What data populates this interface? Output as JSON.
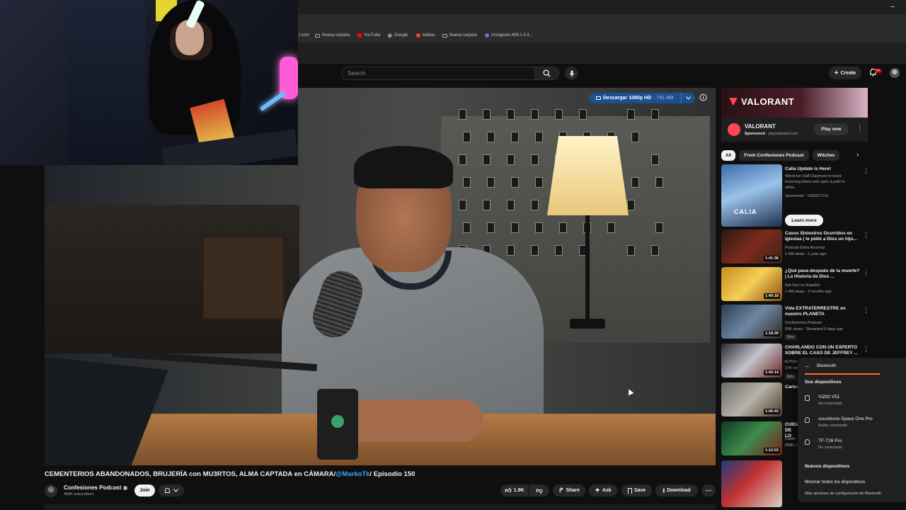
{
  "browser": {
    "bookmarks": [
      {
        "label": "t.com",
        "icon": "link-icon"
      },
      {
        "label": "Nueva carpeta",
        "icon": "folder-icon"
      },
      {
        "label": "YouTube",
        "icon": "youtube-icon"
      },
      {
        "label": "Google",
        "icon": "google-icon"
      },
      {
        "label": "bablas",
        "icon": "site-icon"
      },
      {
        "label": "Nueva carpeta",
        "icon": "folder-icon"
      },
      {
        "label": "Instagram-409.1.0.4...",
        "icon": "instagram-icon"
      }
    ]
  },
  "header": {
    "search_placeholder": "Search",
    "create_label": "Create",
    "notification_count": "9+"
  },
  "video": {
    "download_label": "Descargar 1080p HD",
    "download_size": "· 791 MB",
    "title_prefix": "CEMENTERIOS ABANDONADOS, BRUJERÍA con MU3RTOS, ALMA CAPTADA en CÁMARA/",
    "title_mention": "@MarkoTk",
    "title_suffix": "/ Episodio 150"
  },
  "channel": {
    "name": "Confesiones Podcast",
    "subscribers": "409K subscribers",
    "join_label": "Join"
  },
  "actions": {
    "likes": "1.9K",
    "share": "Share",
    "ask": "Ask",
    "save": "Save",
    "download": "Download"
  },
  "ad": {
    "banner_text": "VALORANT",
    "name": "VALORANT",
    "sponsored": "Sponsored",
    "domain": "· playvalorant.com",
    "cta": "Play now"
  },
  "chips": [
    "All",
    "From Confesiones Podcast",
    "Witches"
  ],
  "recommendations": [
    {
      "title": "Calia Update is Here!",
      "meta1": "Wield her Half Claymore to block incoming blows and open a path to strike.",
      "meta2": "Sponsored · VINDICTUS",
      "duration": "",
      "badge": "",
      "cta": "Learn more"
    },
    {
      "title": "Casos Siniestros Ocurridos en Iglesias | le pidió a Dios un hijo...",
      "meta1": "Podcast Extra Anormal",
      "meta2": "2.4M views · 1 year ago",
      "duration": "1:41:36",
      "badge": ""
    },
    {
      "title": "¿Qué pasa después de la muerte? | La Historia de Dios ...",
      "meta1": "Nat Geo en Español",
      "meta2": "1.4M views · 2 months ago",
      "duration": "1:40:18",
      "badge": ""
    },
    {
      "title": "Vida EXTRATERRESTRE en nuestro PLANETA",
      "meta1": "Confesiones Podcast",
      "meta2": "50K views · Streamed 5 days ago",
      "duration": "1:18:39",
      "badge": "New"
    },
    {
      "title": "CHARLANDO CON UN EXPERTO SOBRE EL CASO DE JEFFREY ...",
      "meta1": "El Poin",
      "meta2": "17K vie",
      "duration": "1:42:14",
      "badge": "New"
    },
    {
      "title": "Carlos",
      "meta1": "",
      "meta2": "",
      "duration": "1:06:43",
      "badge": ""
    },
    {
      "title": "CUIDA DE LO",
      "meta1": "Confe",
      "meta2": "208K v",
      "duration": "1:12:03",
      "badge": ""
    },
    {
      "title": "",
      "meta1": "",
      "meta2": "",
      "duration": "",
      "badge": ""
    }
  ],
  "bluetooth": {
    "title": "Bluetooth",
    "your_devices": "Sus dispositivos",
    "devices": [
      {
        "name": "VIZIO V51",
        "status": "No conectado",
        "icon": "speaker-icon"
      },
      {
        "name": "soundcore Space One Pro",
        "status": "Audio conectado",
        "icon": "headphones-icon"
      },
      {
        "name": "TF-T26 Pro",
        "status": "No conectado",
        "icon": "headphones-icon"
      }
    ],
    "new_devices": "Nuevos dispositivos",
    "show_all": "Mostrar todos los dispositivos",
    "more_settings": "Más opciones de configuración de Bluetooth"
  },
  "colors": {
    "accent_blue": "#3ea6ff",
    "download_bar": "#1c4f8f",
    "valorant_red": "#ff4655",
    "bt_accent": "#ff6a3d"
  }
}
